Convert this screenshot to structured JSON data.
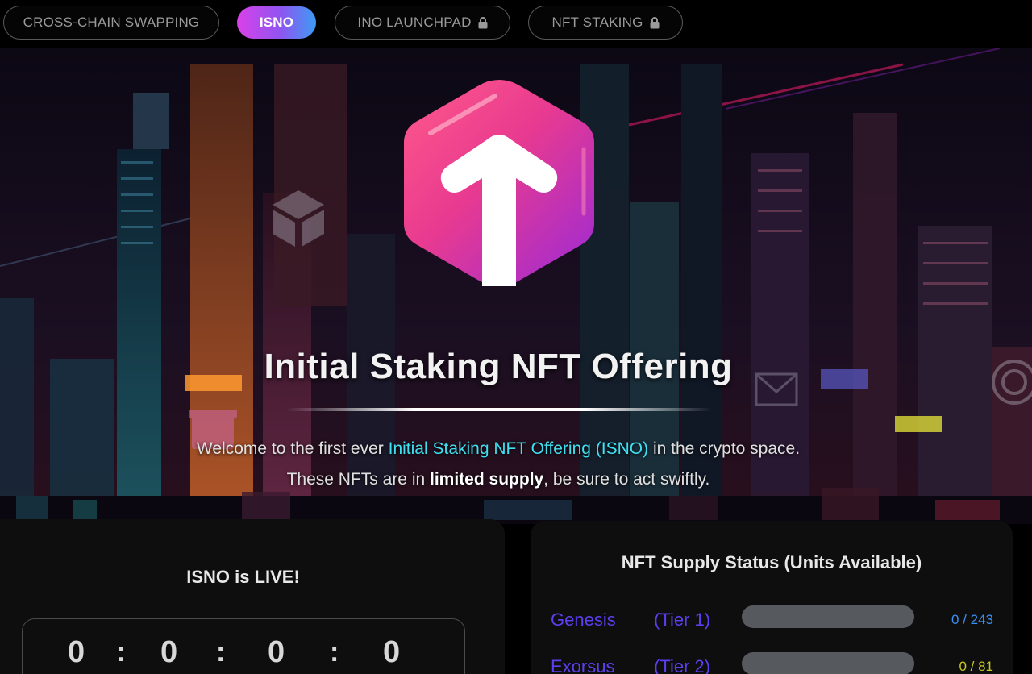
{
  "nav": {
    "items": [
      {
        "label": "CROSS-CHAIN SWAPPING",
        "locked": false,
        "active": false
      },
      {
        "label": "ISNO",
        "locked": false,
        "active": true
      },
      {
        "label": "INO LAUNCHPAD",
        "locked": true,
        "active": false
      },
      {
        "label": "NFT STAKING",
        "locked": true,
        "active": false
      }
    ]
  },
  "hero": {
    "title": "Initial Staking NFT Offering",
    "line1_pre": "Welcome to the first ever ",
    "line1_highlight": "Initial Staking NFT Offering (ISNO)",
    "line1_post": " in the crypto space.",
    "line2_pre": "These NFTs are in ",
    "line2_bold": "limited supply",
    "line2_post": ", be sure to act swiftly."
  },
  "live_panel": {
    "title": "ISNO is LIVE!",
    "countdown": [
      "0",
      "0",
      "0",
      "0"
    ],
    "separator": ":"
  },
  "supply_panel": {
    "title": "NFT Supply Status (Units Available)",
    "tiers": [
      {
        "name": "Genesis",
        "tier": "(Tier 1)",
        "available": 0,
        "total": 243,
        "count_text": "0 / 243",
        "name_color": "#5b3ff0",
        "count_color": "#3a8ff0"
      },
      {
        "name": "Exorsus",
        "tier": "(Tier 2)",
        "available": 0,
        "total": 81,
        "count_text": "0 / 81",
        "name_color": "#5b3ff0",
        "count_color": "#c9c81e"
      }
    ]
  },
  "colors": {
    "accent_cyan": "#3fe0f0",
    "active_gradient_start": "#d941e8",
    "active_gradient_end": "#3d9bf5"
  }
}
